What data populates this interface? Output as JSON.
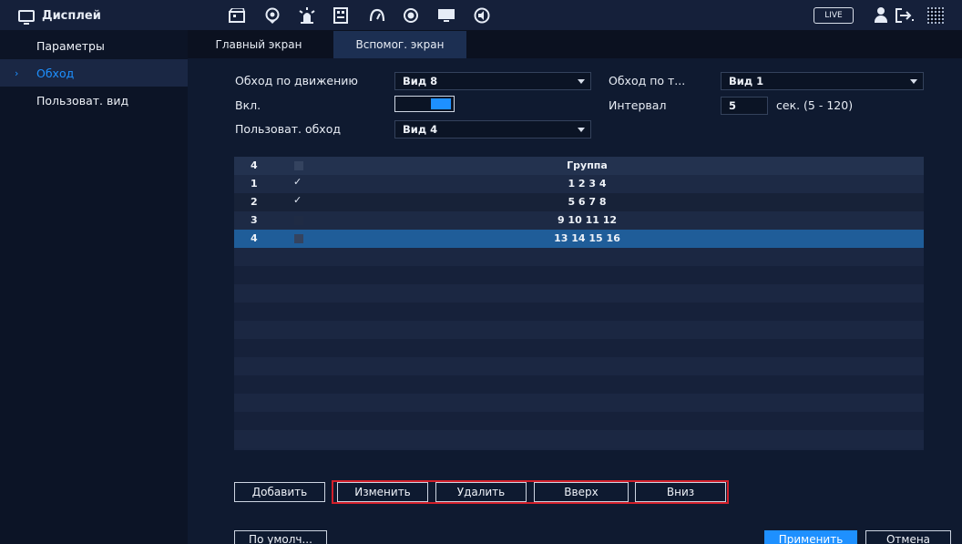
{
  "header": {
    "title": "Дисплей",
    "live_label": "LIVE",
    "icons": [
      "camera-icon",
      "network-icon",
      "alarm-icon",
      "storage-icon",
      "system-icon",
      "record-icon",
      "display-icon",
      "audio-icon"
    ]
  },
  "sidebar": {
    "items": [
      {
        "label": "Параметры"
      },
      {
        "label": "Обход"
      },
      {
        "label": "Пользоват. вид"
      }
    ]
  },
  "tabs": [
    {
      "label": "Главный экран"
    },
    {
      "label": "Вспомог. экран"
    }
  ],
  "form": {
    "motion_tour_label": "Обход по движению",
    "motion_tour_value": "Вид 8",
    "alarm_tour_label": "Обход по т...",
    "alarm_tour_value": "Вид 1",
    "enable_label": "Вкл.",
    "interval_label": "Интервал",
    "interval_value": "5",
    "interval_unit": "сек. (5 - 120)",
    "custom_tour_label": "Пользоват. обход",
    "custom_tour_value": "Вид 4"
  },
  "table": {
    "header_count": "4",
    "header_group": "Группа",
    "rows": [
      {
        "num": "1",
        "checked": true,
        "group": "1 2 3 4"
      },
      {
        "num": "2",
        "checked": true,
        "group": "5 6 7 8"
      },
      {
        "num": "3",
        "checked": false,
        "group": "9 10 11 12"
      },
      {
        "num": "4",
        "checked": false,
        "group": "13 14 15 16"
      }
    ]
  },
  "buttons": {
    "add": "Добавить",
    "edit": "Изменить",
    "delete": "Удалить",
    "up": "Вверх",
    "down": "Вниз",
    "default": "По умолч...",
    "apply": "Применить",
    "cancel": "Отмена"
  },
  "colors": {
    "accent": "#1e90ff",
    "highlight": "#d3202b",
    "selected_row": "#1f5d99"
  }
}
